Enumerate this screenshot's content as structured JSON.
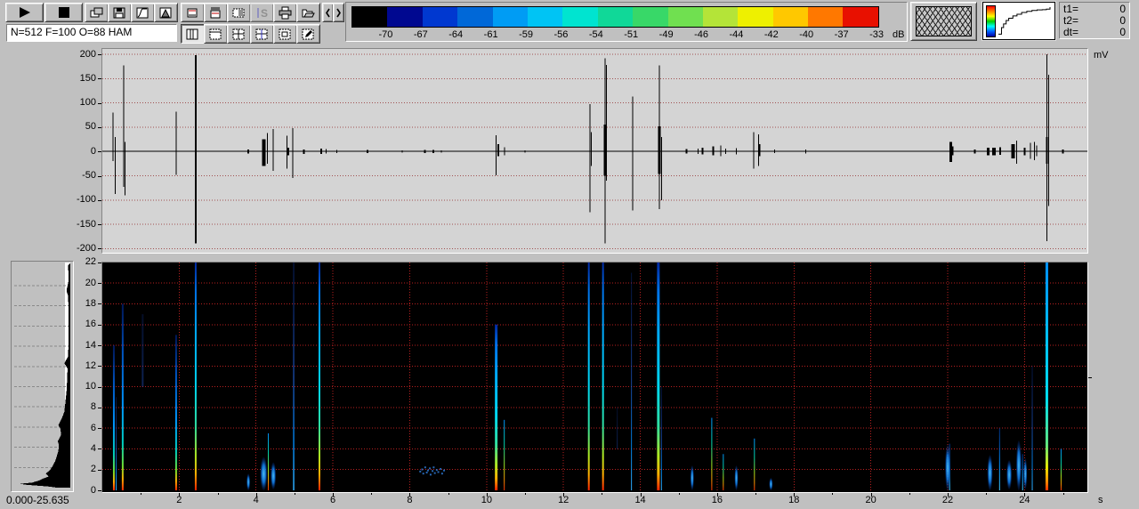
{
  "toolbar": {
    "status_field": "N=512 F=100 O=88 HAM",
    "buttons_row1": [
      "play",
      "stop",
      "copy",
      "save",
      "gain-curve",
      "window-function",
      "display-box",
      "fft-comb",
      "palette-box",
      "s-disabled",
      "print",
      "open",
      "prev",
      "next"
    ],
    "buttons_row2": [
      "layout-vertical",
      "layout-top",
      "layout-quad",
      "layout-quad-cursor",
      "layout-inner",
      "edit"
    ],
    "colorbar": {
      "unit": "dB",
      "labels": [
        "-70",
        "-67",
        "-64",
        "-61",
        "-59",
        "-56",
        "-54",
        "-51",
        "-49",
        "-46",
        "-44",
        "-42",
        "-40",
        "-37",
        "-33"
      ],
      "colors": [
        "#000000",
        "#000890",
        "#0038d0",
        "#0068d8",
        "#009cf4",
        "#00c4f4",
        "#00e4d0",
        "#10d898",
        "#38d868",
        "#70e050",
        "#b4e438",
        "#eef000",
        "#ffc800",
        "#ff7800",
        "#e81000"
      ]
    },
    "time_panel": {
      "rows": [
        {
          "label": "t1=",
          "value": "0"
        },
        {
          "label": "t2=",
          "value": "0"
        },
        {
          "label": "dt=",
          "value": "0"
        }
      ]
    }
  },
  "waveform": {
    "unit": "mV",
    "yticks": [
      200,
      150,
      100,
      50,
      0,
      -50,
      -100,
      -150,
      -200
    ],
    "ylim": [
      -200,
      200
    ],
    "grid_color": "#a05050"
  },
  "spectrogram": {
    "xunit": "s",
    "range_label": "0.000-25.635",
    "yticks": [
      22,
      20,
      18,
      16,
      14,
      12,
      10,
      8,
      6,
      4,
      2,
      0
    ],
    "xticks": [
      2,
      4,
      6,
      8,
      10,
      12,
      14,
      16,
      18,
      20,
      22,
      24
    ],
    "xlim": [
      0,
      25.635
    ],
    "ylim": [
      0,
      22
    ],
    "grid_color": "#b82020"
  },
  "chart_data": [
    {
      "type": "line",
      "name": "waveform-envelope",
      "ylabel": "mV",
      "xlim": [
        0,
        25.635
      ],
      "ylim": [
        -200,
        200
      ],
      "spikes": [
        [
          0.28,
          80,
          -20,
          1
        ],
        [
          0.33,
          30,
          -88,
          1
        ],
        [
          0.55,
          177,
          -73,
          1
        ],
        [
          0.59,
          20,
          -90,
          1
        ],
        [
          1.92,
          82,
          -48,
          1
        ],
        [
          2.43,
          198,
          -189,
          2
        ],
        [
          3.8,
          4,
          -4,
          2
        ],
        [
          4.2,
          25,
          -30,
          4
        ],
        [
          4.3,
          38,
          -25,
          1
        ],
        [
          4.45,
          46,
          -40,
          1
        ],
        [
          4.8,
          32,
          -35,
          1
        ],
        [
          4.83,
          8,
          -8,
          3
        ],
        [
          4.95,
          48,
          -55,
          1
        ],
        [
          5.25,
          4,
          -5,
          2
        ],
        [
          5.7,
          6,
          -5,
          2
        ],
        [
          5.82,
          5,
          -4,
          1
        ],
        [
          6.1,
          3,
          -3,
          1
        ],
        [
          6.9,
          3,
          -3,
          2
        ],
        [
          7.8,
          2,
          -2,
          1
        ],
        [
          8.4,
          3,
          -3,
          2
        ],
        [
          8.62,
          3,
          -3,
          2
        ],
        [
          8.82,
          2,
          -2,
          1
        ],
        [
          10.25,
          33,
          -49,
          1
        ],
        [
          10.3,
          15,
          -10,
          2
        ],
        [
          10.47,
          9,
          -8,
          1
        ],
        [
          11.0,
          2,
          -2,
          1
        ],
        [
          12.69,
          97,
          -125,
          1
        ],
        [
          12.73,
          40,
          -30,
          1
        ],
        [
          13.08,
          192,
          -189,
          1
        ],
        [
          13.08,
          55,
          -50,
          3
        ],
        [
          13.12,
          178,
          -60,
          1
        ],
        [
          13.8,
          113,
          -121,
          1
        ],
        [
          14.5,
          177,
          -119,
          1
        ],
        [
          14.5,
          52,
          -46,
          3
        ],
        [
          14.56,
          30,
          -100,
          1
        ],
        [
          15.2,
          5,
          -4,
          2
        ],
        [
          15.5,
          6,
          -5,
          1
        ],
        [
          15.62,
          8,
          -6,
          2
        ],
        [
          15.9,
          10,
          -8,
          2
        ],
        [
          16.1,
          12,
          -10,
          1
        ],
        [
          16.22,
          6,
          -5,
          1
        ],
        [
          16.5,
          7,
          -6,
          1
        ],
        [
          16.95,
          40,
          -35,
          1
        ],
        [
          17.08,
          35,
          -30,
          1
        ],
        [
          17.1,
          15,
          -10,
          2
        ],
        [
          17.5,
          4,
          -3,
          1
        ],
        [
          18.3,
          4,
          -4,
          1
        ],
        [
          22.08,
          20,
          -22,
          3
        ],
        [
          22.13,
          10,
          -8,
          2
        ],
        [
          22.7,
          4,
          -4,
          2
        ],
        [
          23.05,
          8,
          -8,
          3
        ],
        [
          23.2,
          8,
          -8,
          4
        ],
        [
          23.37,
          9,
          -7,
          2
        ],
        [
          23.7,
          15,
          -14,
          4
        ],
        [
          23.79,
          22,
          -25,
          1
        ],
        [
          24.0,
          8,
          -8,
          2
        ],
        [
          24.15,
          18,
          -15,
          1
        ],
        [
          24.26,
          20,
          -18,
          1
        ],
        [
          24.32,
          12,
          -10,
          1
        ],
        [
          24.58,
          200,
          -185,
          1
        ],
        [
          24.58,
          30,
          -25,
          2
        ],
        [
          24.63,
          158,
          -112,
          1
        ],
        [
          25.0,
          4,
          -4,
          2
        ]
      ]
    },
    {
      "type": "heatmap",
      "name": "spectrogram",
      "xlim": [
        0,
        25.635
      ],
      "ylim": [
        0,
        22
      ],
      "colormap_db": [
        -70,
        -67,
        -64,
        -61,
        -59,
        -56,
        -54,
        -51,
        -49,
        -46,
        -44,
        -42,
        -40,
        -37,
        -33
      ],
      "streaks": [
        [
          0.3,
          0,
          14,
          2,
          "medium"
        ],
        [
          0.36,
          0,
          9,
          1,
          "faint"
        ],
        [
          0.53,
          0,
          18,
          2,
          "medium"
        ],
        [
          1.05,
          10,
          17,
          2,
          "vfaint"
        ],
        [
          1.92,
          0,
          15,
          2,
          "medium"
        ],
        [
          2.43,
          0,
          22,
          2,
          "strong"
        ],
        [
          4.32,
          0,
          5.5,
          1,
          "short"
        ],
        [
          4.98,
          0,
          22,
          1.5,
          "faint"
        ],
        [
          5.65,
          0,
          22,
          2,
          "strong"
        ],
        [
          10.25,
          0,
          16,
          3,
          "strong"
        ],
        [
          10.46,
          0,
          6.8,
          1,
          "short"
        ],
        [
          12.66,
          0,
          22,
          2,
          "strong"
        ],
        [
          13.03,
          0,
          22,
          2,
          "strong"
        ],
        [
          13.4,
          4,
          8,
          1,
          "vfaint"
        ],
        [
          13.77,
          0,
          21,
          1,
          "faint"
        ],
        [
          14.47,
          0,
          22,
          3,
          "strong"
        ],
        [
          14.55,
          0,
          10,
          1,
          "faint"
        ],
        [
          15.86,
          0,
          7,
          1,
          "short"
        ],
        [
          16.16,
          0,
          3.5,
          1,
          "short"
        ],
        [
          16.97,
          0,
          5,
          1,
          "short"
        ],
        [
          22.05,
          0,
          4.5,
          1,
          "shortblue"
        ],
        [
          23.35,
          0,
          6,
          1,
          "shortblue"
        ],
        [
          23.95,
          0,
          3.5,
          1,
          "shortblue"
        ],
        [
          24.2,
          0,
          12,
          1,
          "faint"
        ],
        [
          24.58,
          0,
          22,
          3,
          "strongcyan"
        ],
        [
          24.95,
          0,
          4,
          1,
          "short"
        ]
      ],
      "blobs": [
        [
          3.8,
          0.8,
          2,
          0.8
        ],
        [
          4.2,
          1.6,
          4,
          1.6
        ],
        [
          4.45,
          1.4,
          3,
          1.3
        ],
        [
          15.35,
          1.2,
          2,
          1.2
        ],
        [
          16.5,
          1.2,
          2,
          1.2
        ],
        [
          17.4,
          0.6,
          2,
          0.6
        ],
        [
          22.0,
          2.2,
          3,
          2.2
        ],
        [
          23.1,
          1.7,
          3,
          1.7
        ],
        [
          23.6,
          1.5,
          3,
          1.4
        ],
        [
          23.85,
          2.4,
          3,
          2.4
        ],
        [
          24.02,
          1.6,
          2,
          1.5
        ]
      ],
      "speckles": [
        [
          8.25,
          1.9
        ],
        [
          8.3,
          2.1
        ],
        [
          8.33,
          1.7
        ],
        [
          8.38,
          2.3
        ],
        [
          8.42,
          1.8
        ],
        [
          8.45,
          2.0
        ],
        [
          8.5,
          2.2
        ],
        [
          8.52,
          1.6
        ],
        [
          8.57,
          1.95
        ],
        [
          8.6,
          2.3
        ],
        [
          8.63,
          1.75
        ],
        [
          8.68,
          2.05
        ],
        [
          8.72,
          1.85
        ],
        [
          8.78,
          2.15
        ],
        [
          8.82,
          1.7
        ],
        [
          8.87,
          2.0
        ]
      ]
    },
    {
      "type": "area",
      "name": "average-spectrum",
      "range_label": "0.000-25.635",
      "points": [
        [
          22,
          0.04
        ],
        [
          20.5,
          0.03
        ],
        [
          19.5,
          0.07
        ],
        [
          19,
          0.04
        ],
        [
          17,
          0.03
        ],
        [
          15,
          0.03
        ],
        [
          13,
          0.04
        ],
        [
          12.3,
          0.11
        ],
        [
          11.8,
          0.05
        ],
        [
          10.5,
          0.06
        ],
        [
          9.5,
          0.07
        ],
        [
          8.5,
          0.09
        ],
        [
          7.5,
          0.11
        ],
        [
          6.8,
          0.16
        ],
        [
          6.2,
          0.22
        ],
        [
          5.8,
          0.18
        ],
        [
          5.2,
          0.17
        ],
        [
          4.6,
          0.23
        ],
        [
          4.2,
          0.21
        ],
        [
          3.6,
          0.22
        ],
        [
          3.1,
          0.25
        ],
        [
          2.6,
          0.28
        ],
        [
          2.1,
          0.33
        ],
        [
          1.7,
          0.38
        ],
        [
          1.4,
          0.45
        ],
        [
          1.1,
          0.4
        ],
        [
          0.9,
          0.5
        ],
        [
          0.7,
          0.58
        ],
        [
          0.5,
          0.7
        ],
        [
          0.38,
          0.93
        ],
        [
          0.28,
          0.8
        ],
        [
          0.18,
          0.56
        ],
        [
          0.1,
          0.38
        ],
        [
          0,
          0.25
        ]
      ]
    },
    {
      "type": "line",
      "name": "transfer-curve",
      "points": [
        [
          0,
          0.02
        ],
        [
          0.06,
          0.25
        ],
        [
          0.1,
          0.38
        ],
        [
          0.15,
          0.5
        ],
        [
          0.2,
          0.58
        ],
        [
          0.28,
          0.66
        ],
        [
          0.36,
          0.72
        ],
        [
          0.45,
          0.78
        ],
        [
          0.55,
          0.82
        ],
        [
          0.65,
          0.85
        ],
        [
          0.75,
          0.87
        ],
        [
          0.85,
          0.88
        ],
        [
          0.93,
          0.9
        ],
        [
          1,
          0.97
        ]
      ]
    }
  ]
}
